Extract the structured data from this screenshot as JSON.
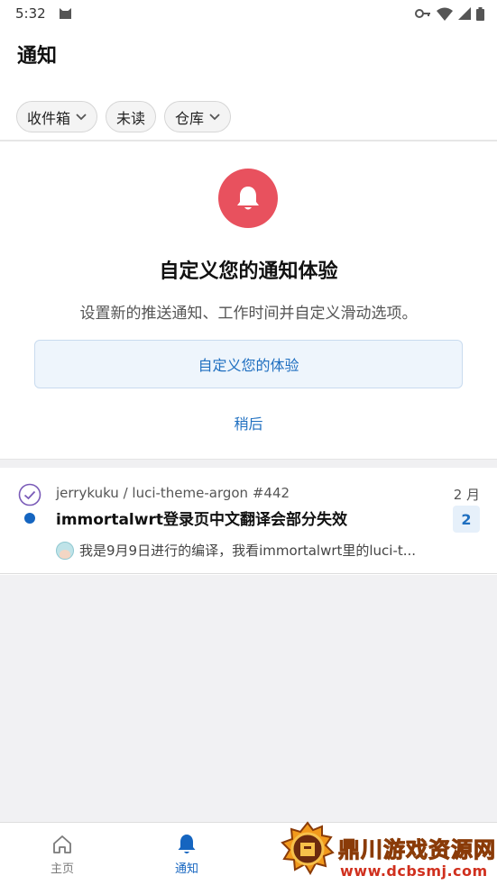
{
  "status_bar": {
    "time": "5:32"
  },
  "header": {
    "title": "通知"
  },
  "filters": [
    {
      "label": "收件箱",
      "has_dropdown": true
    },
    {
      "label": "未读",
      "has_dropdown": false
    },
    {
      "label": "仓库",
      "has_dropdown": true
    }
  ],
  "promo": {
    "icon": "bell-icon",
    "title": "自定义您的通知体验",
    "description": "设置新的推送通知、工作时间并自定义滑动选项。",
    "primary_label": "自定义您的体验",
    "later_label": "稍后",
    "accent_color": "#e8515e"
  },
  "notifications": [
    {
      "repo": "jerrykuku / luci-theme-argon #442",
      "date": "2 月",
      "title": "immortalwrt登录页中文翻译会部分失效",
      "count": "2",
      "preview": "我是9月9日进行的编译，我看immortalwrt里的luci-t..."
    }
  ],
  "bottom_nav": {
    "home_label": "主页",
    "notifications_label": "通知"
  },
  "watermark": {
    "name": "鼎川游戏资源网",
    "url": "www.dcbsmj.com"
  },
  "colors": {
    "link": "#1f6fc0",
    "active_nav": "#1565c0"
  }
}
